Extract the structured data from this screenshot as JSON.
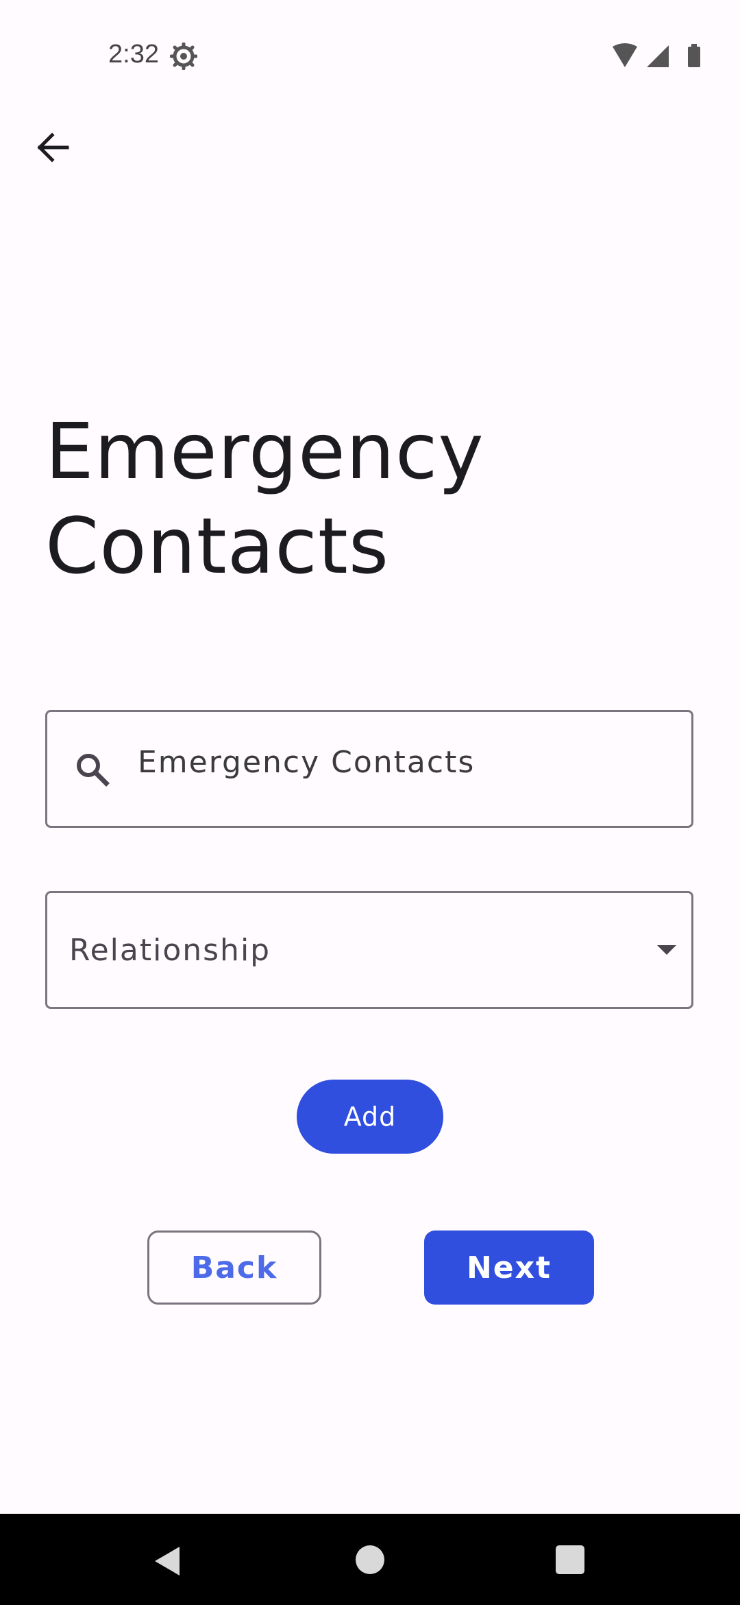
{
  "status_bar": {
    "time": "2:32",
    "settings_icon": "gear-icon",
    "wifi_icon": "wifi-icon",
    "signal_icon": "cellular-signal-icon",
    "battery_icon": "battery-icon"
  },
  "header": {
    "back_icon": "arrow-back-icon"
  },
  "page": {
    "title_line1": "Emergency",
    "title_line2": "Contacts"
  },
  "search": {
    "icon": "search-icon",
    "value": "Emergency Contacts"
  },
  "relationship": {
    "label": "Relationship",
    "icon": "dropdown-arrow-icon"
  },
  "actions": {
    "add_label": "Add",
    "back_label": "Back",
    "next_label": "Next"
  },
  "colors": {
    "primary": "#304fde",
    "back_text": "#4d6ae8",
    "outline": "#79747e",
    "background": "#fffbfe"
  },
  "nav_bar": {
    "back_icon": "nav-back-icon",
    "home_icon": "nav-home-icon",
    "recents_icon": "nav-recents-icon"
  }
}
